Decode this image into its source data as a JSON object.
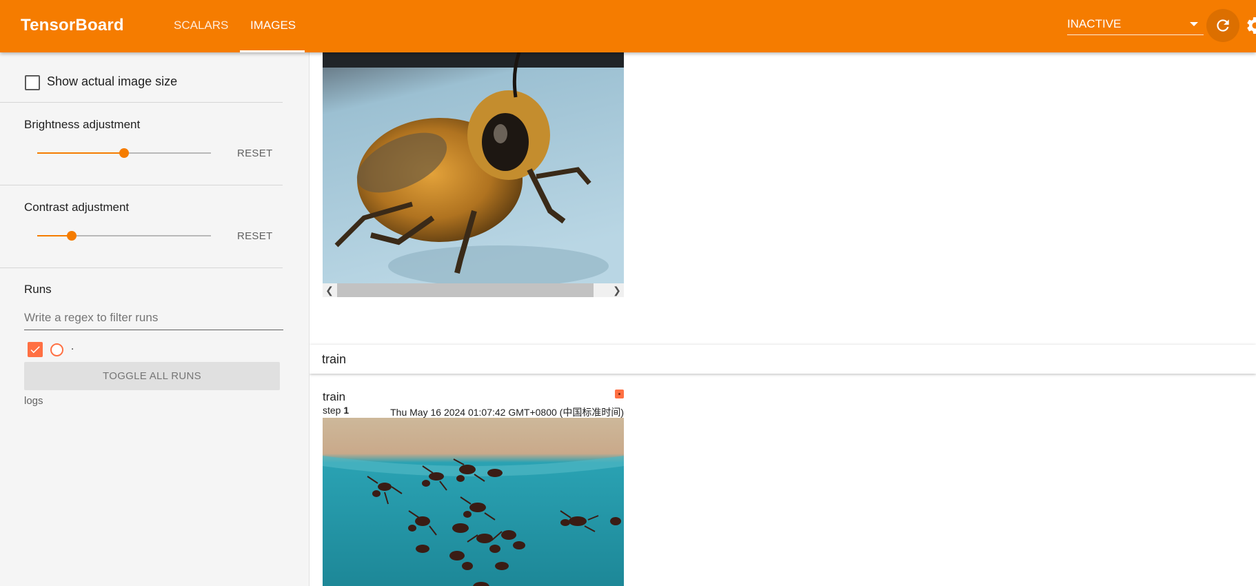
{
  "header": {
    "title": "TensorBoard",
    "tabs": [
      {
        "label": "SCALARS",
        "active": false
      },
      {
        "label": "IMAGES",
        "active": true
      }
    ],
    "status_select": "INACTIVE",
    "reload_icon": "refresh-icon",
    "settings_icon": "gear-icon",
    "accent_color": "#f57c00"
  },
  "sidebar": {
    "show_actual_size_label": "Show actual image size",
    "show_actual_size_checked": false,
    "brightness": {
      "label": "Brightness adjustment",
      "value_fraction": 0.5,
      "reset_label": "RESET"
    },
    "contrast": {
      "label": "Contrast adjustment",
      "value_fraction": 0.2,
      "reset_label": "RESET"
    },
    "runs": {
      "heading": "Runs",
      "filter_placeholder": "Write a regex to filter runs",
      "items": [
        {
          "name": ".",
          "checked": true,
          "color": "#ff7043"
        }
      ],
      "toggle_all_label": "TOGGLE ALL RUNS",
      "logdir": "logs"
    }
  },
  "main": {
    "group_title": "train",
    "card": {
      "title": "train",
      "step_label": "step",
      "step_value": "1",
      "timestamp": "Thu May 16 2024 01:07:42 GMT+0800 (中国标准时间)"
    }
  }
}
